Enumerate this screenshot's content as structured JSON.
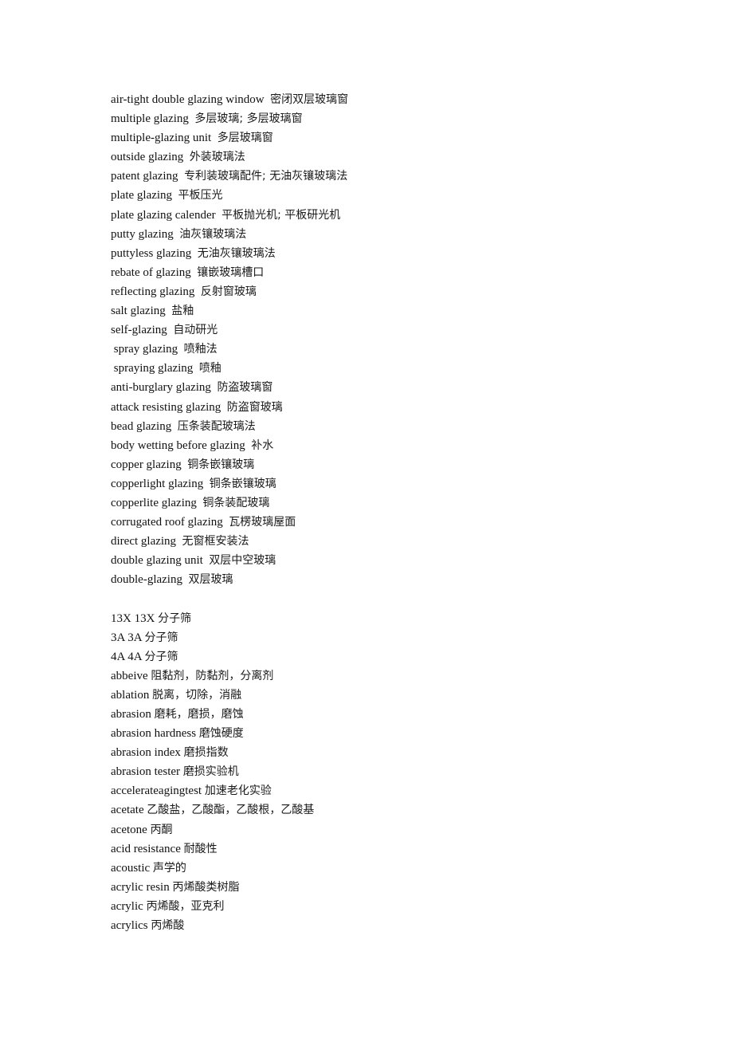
{
  "document": {
    "section_glazing": [
      {
        "en": "air-tight double glazing window",
        "sep": "  ",
        "cn": "密闭双层玻璃窗"
      },
      {
        "en": "multiple glazing",
        "sep": "  ",
        "cn": "多层玻璃; 多层玻璃窗"
      },
      {
        "en": "multiple-glazing unit",
        "sep": "  ",
        "cn": "多层玻璃窗"
      },
      {
        "en": "outside glazing",
        "sep": "  ",
        "cn": "外装玻璃法"
      },
      {
        "en": "patent glazing",
        "sep": "  ",
        "cn": "专利装玻璃配件; 无油灰镶玻璃法"
      },
      {
        "en": "plate glazing",
        "sep": "  ",
        "cn": "平板压光"
      },
      {
        "en": "plate glazing calender",
        "sep": "  ",
        "cn": "平板抛光机; 平板研光机"
      },
      {
        "en": "putty glazing",
        "sep": "  ",
        "cn": "油灰镶玻璃法"
      },
      {
        "en": "puttyless glazing",
        "sep": "  ",
        "cn": "无油灰镶玻璃法"
      },
      {
        "en": "rebate of glazing",
        "sep": "  ",
        "cn": "镶嵌玻璃槽口"
      },
      {
        "en": "reflecting glazing",
        "sep": "  ",
        "cn": "反射窗玻璃"
      },
      {
        "en": "salt glazing",
        "sep": "  ",
        "cn": "盐釉"
      },
      {
        "en": "self-glazing",
        "sep": "  ",
        "cn": "自动研光"
      },
      {
        "en": " spray glazing",
        "sep": "  ",
        "cn": "喷釉法"
      },
      {
        "en": " spraying glazing",
        "sep": "  ",
        "cn": "喷釉"
      },
      {
        "en": "anti-burglary glazing",
        "sep": "  ",
        "cn": "防盗玻璃窗"
      },
      {
        "en": "attack resisting glazing",
        "sep": "  ",
        "cn": "防盗窗玻璃"
      },
      {
        "en": "bead glazing",
        "sep": "  ",
        "cn": "压条装配玻璃法"
      },
      {
        "en": "body wetting before glazing",
        "sep": "  ",
        "cn": "补水"
      },
      {
        "en": "copper glazing",
        "sep": "  ",
        "cn": "铜条嵌镶玻璃"
      },
      {
        "en": "copperlight glazing",
        "sep": "  ",
        "cn": "铜条嵌镶玻璃"
      },
      {
        "en": "copperlite glazing",
        "sep": "  ",
        "cn": "铜条装配玻璃"
      },
      {
        "en": "corrugated roof glazing",
        "sep": "  ",
        "cn": "瓦楞玻璃屋面"
      },
      {
        "en": "direct glazing",
        "sep": "  ",
        "cn": "无窗框安装法"
      },
      {
        "en": "double glazing unit",
        "sep": "  ",
        "cn": "双层中空玻璃"
      },
      {
        "en": "double-glazing",
        "sep": "  ",
        "cn": "双层玻璃"
      }
    ],
    "section_general": [
      {
        "en": "13X 13X",
        "sep": " ",
        "cn": "分子筛"
      },
      {
        "en": "3A 3A",
        "sep": " ",
        "cn": "分子筛"
      },
      {
        "en": "4A 4A",
        "sep": " ",
        "cn": "分子筛"
      },
      {
        "en": "abbeive",
        "sep": " ",
        "cn": "阻黏剂，防黏剂，分离剂"
      },
      {
        "en": "ablation",
        "sep": " ",
        "cn": "脱离，切除，消融"
      },
      {
        "en": "abrasion",
        "sep": " ",
        "cn": "磨耗，磨损，磨蚀"
      },
      {
        "en": "abrasion hardness",
        "sep": " ",
        "cn": "磨蚀硬度"
      },
      {
        "en": "abrasion index",
        "sep": " ",
        "cn": "磨损指数"
      },
      {
        "en": "abrasion tester",
        "sep": " ",
        "cn": "磨损实验机"
      },
      {
        "en": "accelerateagingtest",
        "sep": " ",
        "cn": "加速老化实验"
      },
      {
        "en": "acetate",
        "sep": " ",
        "cn": "乙酸盐，乙酸酯，乙酸根，乙酸基"
      },
      {
        "en": "acetone",
        "sep": " ",
        "cn": "丙酮"
      },
      {
        "en": "acid resistance",
        "sep": " ",
        "cn": "耐酸性"
      },
      {
        "en": "acoustic",
        "sep": " ",
        "cn": "声学的"
      },
      {
        "en": "acrylic resin",
        "sep": " ",
        "cn": "丙烯酸类树脂"
      },
      {
        "en": "acrylic",
        "sep": " ",
        "cn": "丙烯酸，亚克利"
      },
      {
        "en": "acrylics",
        "sep": " ",
        "cn": "丙烯酸"
      }
    ]
  }
}
